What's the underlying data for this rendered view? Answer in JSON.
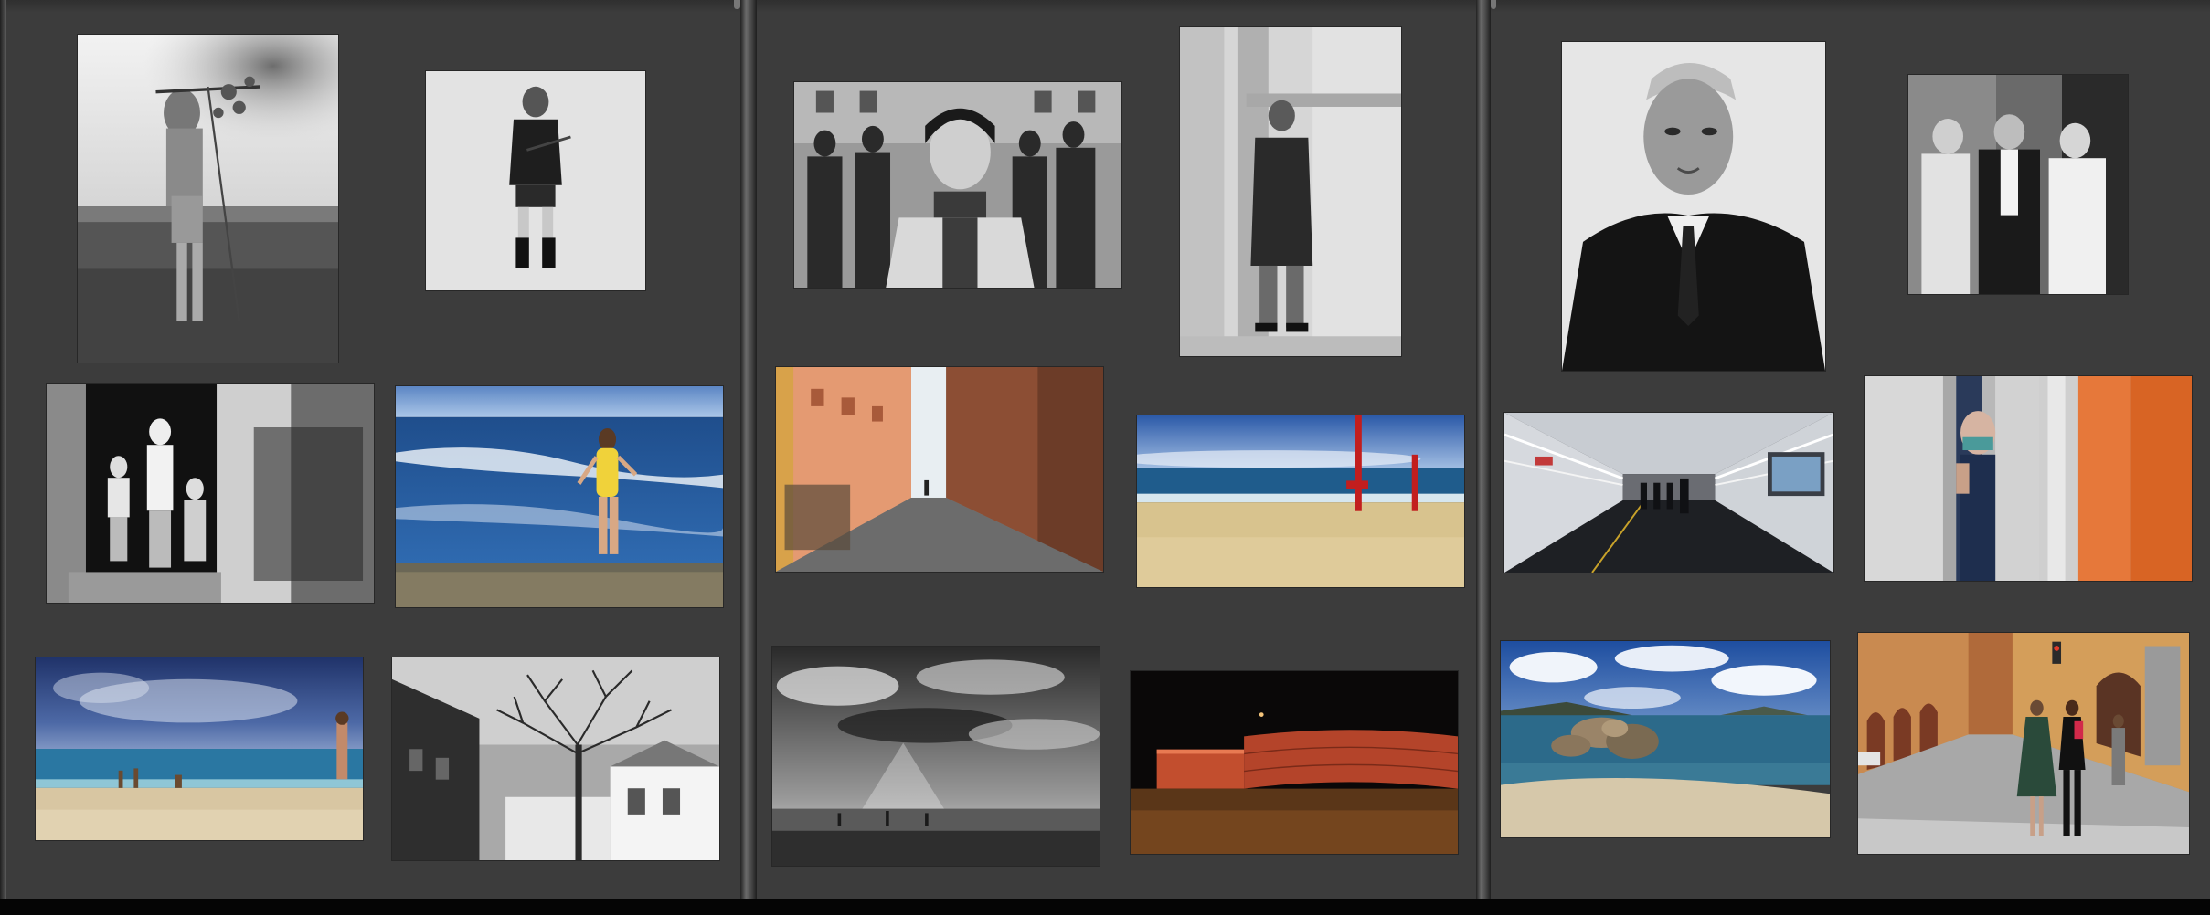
{
  "app": {
    "name": "photo-gallery-wall",
    "colors": {
      "background": "#3c3c3c",
      "divider": "#5a5a5a",
      "bottom_bar": "#050505"
    }
  },
  "panels": [
    {
      "id": "panel-1",
      "photos": [
        {
          "id": "p1",
          "subject": "child-with-branch",
          "style": "black-and-white"
        },
        {
          "id": "p2",
          "subject": "boy-in-jacket",
          "style": "black-and-white"
        },
        {
          "id": "p3",
          "subject": "children-in-doorway",
          "style": "black-and-white"
        },
        {
          "id": "p4",
          "subject": "girl-at-sea",
          "style": "color"
        },
        {
          "id": "p5",
          "subject": "beach-under-clouds",
          "style": "color"
        },
        {
          "id": "p6",
          "subject": "bare-tree-and-houses",
          "style": "black-and-white"
        }
      ]
    },
    {
      "id": "panel-2",
      "photos": [
        {
          "id": "p7",
          "subject": "youth-group-portrait",
          "style": "black-and-white"
        },
        {
          "id": "p8",
          "subject": "boy-against-column",
          "style": "black-and-white"
        },
        {
          "id": "p9",
          "subject": "narrow-street",
          "style": "color"
        },
        {
          "id": "p10",
          "subject": "red-poles-on-beach",
          "style": "color"
        },
        {
          "id": "p11",
          "subject": "stormy-sky-over-sea",
          "style": "black-and-white"
        },
        {
          "id": "p12",
          "subject": "brick-wall-at-night",
          "style": "color"
        }
      ]
    },
    {
      "id": "panel-3",
      "photos": [
        {
          "id": "p13",
          "subject": "old-man-portrait",
          "style": "black-and-white"
        },
        {
          "id": "p14",
          "subject": "three-elderly-men",
          "style": "black-and-white"
        },
        {
          "id": "p15",
          "subject": "pedestrian-tunnel",
          "style": "color"
        },
        {
          "id": "p16",
          "subject": "man-behind-door",
          "style": "color"
        },
        {
          "id": "p17",
          "subject": "rocks-by-the-sea",
          "style": "color"
        },
        {
          "id": "p18",
          "subject": "arcade-street-walkers",
          "style": "color"
        }
      ]
    }
  ]
}
